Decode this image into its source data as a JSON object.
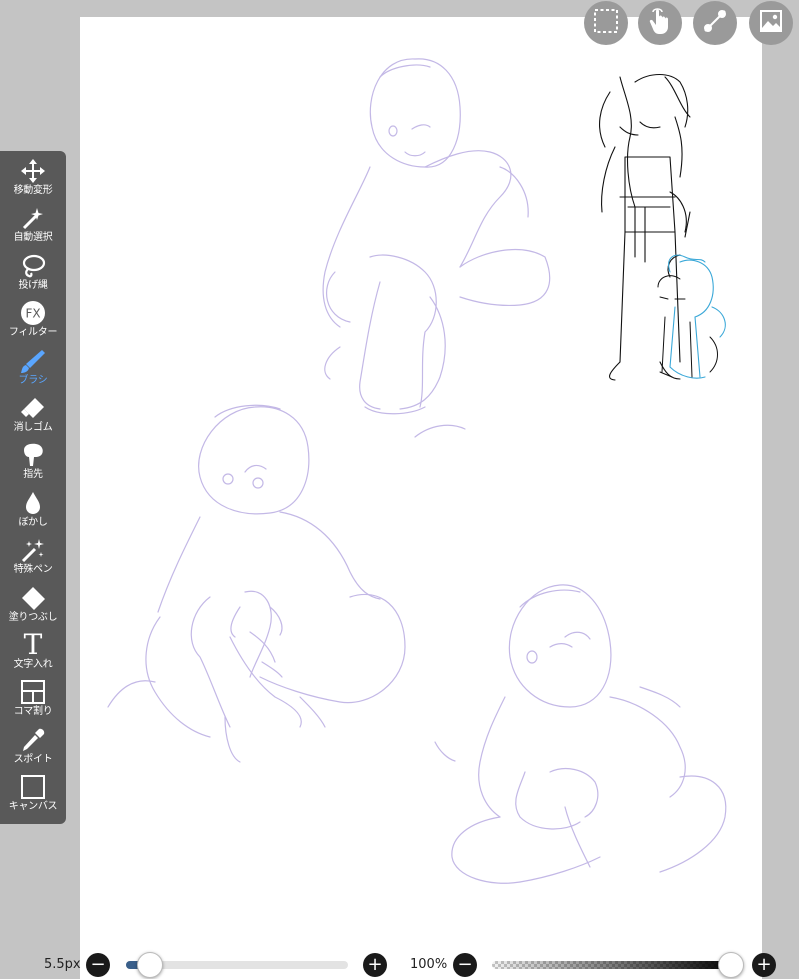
{
  "toolbar": {
    "items": [
      {
        "label": "移動変形",
        "icon": "move-icon"
      },
      {
        "label": "自動選択",
        "icon": "magic-wand-icon"
      },
      {
        "label": "投げ縄",
        "icon": "lasso-icon"
      },
      {
        "label": "フィルター",
        "icon": "fx-icon"
      },
      {
        "label": "ブラシ",
        "icon": "brush-icon",
        "active": true
      },
      {
        "label": "消しゴム",
        "icon": "eraser-icon"
      },
      {
        "label": "指先",
        "icon": "smudge-finger-icon"
      },
      {
        "label": "ぼかし",
        "icon": "blur-drop-icon"
      },
      {
        "label": "特殊ペン",
        "icon": "special-pen-icon"
      },
      {
        "label": "塗りつぶし",
        "icon": "fill-bucket-icon"
      },
      {
        "label": "文字入れ",
        "icon": "text-icon"
      },
      {
        "label": "コマ割り",
        "icon": "panel-layout-icon"
      },
      {
        "label": "スポイト",
        "icon": "eyedropper-icon"
      },
      {
        "label": "キャンバス",
        "icon": "canvas-icon"
      }
    ],
    "fx_glyph": "FX",
    "text_glyph": "T"
  },
  "top_buttons": [
    "selection-icon",
    "touch-gesture-icon",
    "ruler-icon",
    "layers-icon"
  ],
  "bottom": {
    "brush_size": "5.5px",
    "zoom": "100%",
    "minus": "−",
    "plus": "+",
    "brush_size_level": 0.11,
    "opacity_level": 0.95
  },
  "colors": {
    "active_tool": "#5aa6ff",
    "sketch_stroke": "#b9aee0",
    "toolbar_bg": "#595959"
  }
}
